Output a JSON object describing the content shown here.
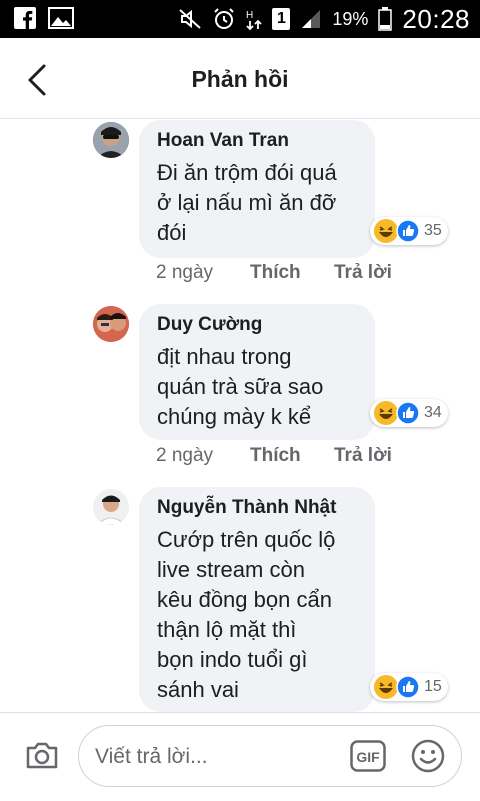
{
  "status_bar": {
    "battery_percent": "19%",
    "time": "20:28",
    "sim_slot": "1",
    "icons": [
      "facebook-icon",
      "gallery-icon",
      "mute-icon",
      "alarm-icon",
      "data-arrows-icon",
      "sim-icon",
      "signal-icon",
      "battery-icon"
    ]
  },
  "header": {
    "title": "Phản hồi",
    "back_icon": "chevron-left-icon"
  },
  "comments": [
    {
      "author": "Hoan Van Tran",
      "text": "Đi ăn trộm đói quá\nở lại nấu mì ăn đỡ\nđói",
      "reaction_count": "35",
      "reactions": [
        "haha",
        "like"
      ],
      "time": "2 ngày",
      "like_label": "Thích",
      "reply_label": "Trả lời"
    },
    {
      "author": "Duy Cường",
      "text": "địt nhau trong\nquán trà sữa sao\nchúng mày k kể",
      "reaction_count": "34",
      "reactions": [
        "haha",
        "like"
      ],
      "time": "2 ngày",
      "like_label": "Thích",
      "reply_label": "Trả lời"
    },
    {
      "author": "Nguyễn Thành Nhật",
      "text": "Cướp trên quốc lộ\nlive stream còn\nkêu đồng bọn cẩn\nthận lộ mặt thì\nbọn indo tuổi gì\nsánh vai",
      "reaction_count": "15",
      "reactions": [
        "haha",
        "like"
      ]
    }
  ],
  "composer": {
    "placeholder": "Viết trả lời...",
    "gif_label": "GIF"
  },
  "colors": {
    "accent": "#1877f2",
    "bubble": "#f0f2f5",
    "haha": "#f7b928"
  }
}
